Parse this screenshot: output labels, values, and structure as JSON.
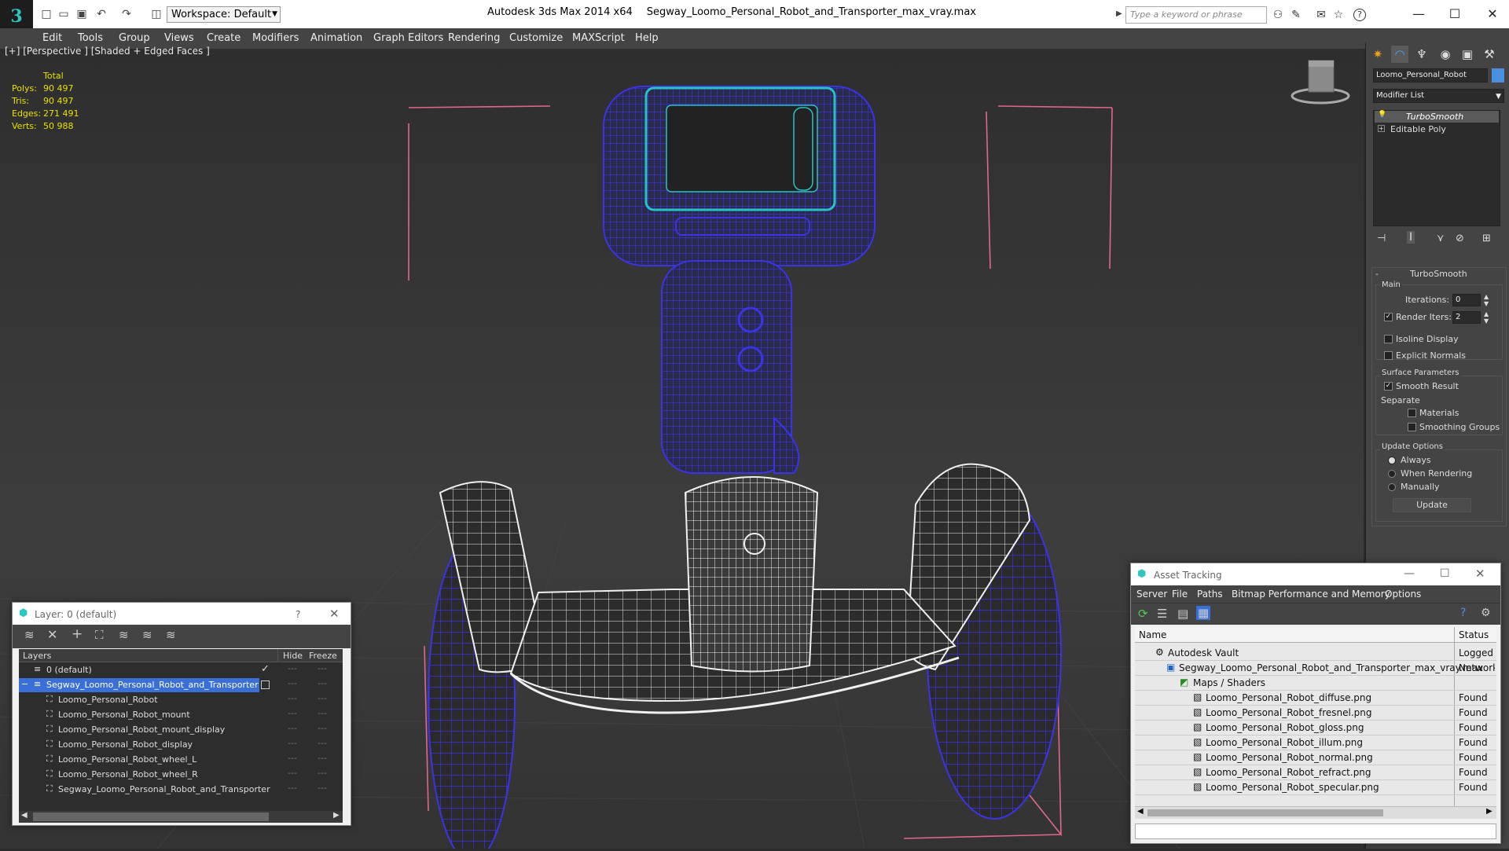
{
  "app": {
    "title": "Autodesk 3ds Max  2014 x64",
    "file": "Segway_Loomo_Personal_Robot_and_Transporter_max_vray.max",
    "workspace": "Workspace: Default",
    "search_placeholder": "Type a keyword or phrase"
  },
  "menu": [
    "Edit",
    "Tools",
    "Group",
    "Views",
    "Create",
    "Modifiers",
    "Animation",
    "Graph Editors",
    "Rendering",
    "Customize",
    "MAXScript",
    "Help"
  ],
  "viewport": {
    "label": "[+] [Perspective ] [Shaded + Edged Faces ]",
    "stats": {
      "header": "Total",
      "rows": [
        {
          "label": "Polys:",
          "value": "90 497"
        },
        {
          "label": "Tris:",
          "value": "90 497"
        },
        {
          "label": "Edges:",
          "value": "271 491"
        },
        {
          "label": "Verts:",
          "value": "50 988"
        }
      ]
    }
  },
  "command_panel": {
    "object_name": "Loomo_Personal_Robot",
    "modifier_list": "Modifier List",
    "stack": [
      "TurboSmooth",
      "Editable Poly"
    ],
    "rollout": "TurboSmooth",
    "main_group": "Main",
    "iterations_label": "Iterations:",
    "iterations": "0",
    "render_iters_label": "Render Iters:",
    "render_iters": "2",
    "isoline": "Isoline Display",
    "explicit": "Explicit Normals",
    "surface_group": "Surface Parameters",
    "smooth_result": "Smooth Result",
    "separate": "Separate",
    "materials": "Materials",
    "smoothing_groups": "Smoothing Groups",
    "update_group": "Update Options",
    "always": "Always",
    "when_rendering": "When Rendering",
    "manually": "Manually",
    "update_btn": "Update"
  },
  "layer_dialog": {
    "title": "Layer: 0 (default)",
    "help": "?",
    "col_layers": "Layers",
    "col_hide": "Hide",
    "col_freeze": "Freeze",
    "rows": [
      "0 (default)",
      "Segway_Loomo_Personal_Robot_and_Transporter",
      "Loomo_Personal_Robot",
      "Loomo_Personal_Robot_mount",
      "Loomo_Personal_Robot_mount_display",
      "Loomo_Personal_Robot_display",
      "Loomo_Personal_Robot_wheel_L",
      "Loomo_Personal_Robot_wheel_R",
      "Segway_Loomo_Personal_Robot_and_Transporter"
    ]
  },
  "asset_tracking": {
    "title": "Asset Tracking",
    "menu": [
      "Server",
      "File",
      "Paths",
      "Bitmap Performance and Memory",
      "Options"
    ],
    "col_name": "Name",
    "col_status": "Status",
    "rows": [
      {
        "name": "Autodesk Vault",
        "status": "Logged O"
      },
      {
        "name": "Segway_Loomo_Personal_Robot_and_Transporter_max_vray.max",
        "status": "Network"
      },
      {
        "name": "Maps / Shaders",
        "status": ""
      },
      {
        "name": "Loomo_Personal_Robot_diffuse.png",
        "status": "Found"
      },
      {
        "name": "Loomo_Personal_Robot_fresnel.png",
        "status": "Found"
      },
      {
        "name": "Loomo_Personal_Robot_gloss.png",
        "status": "Found"
      },
      {
        "name": "Loomo_Personal_Robot_illum.png",
        "status": "Found"
      },
      {
        "name": "Loomo_Personal_Robot_normal.png",
        "status": "Found"
      },
      {
        "name": "Loomo_Personal_Robot_refract.png",
        "status": "Found"
      },
      {
        "name": "Loomo_Personal_Robot_specular.png",
        "status": "Found"
      }
    ]
  },
  "colors": {
    "wire_blue": "#3c33e6",
    "wire_white": "#f2f2f2",
    "selection": "#3a6fd8",
    "accent": "#2ec7c0"
  }
}
